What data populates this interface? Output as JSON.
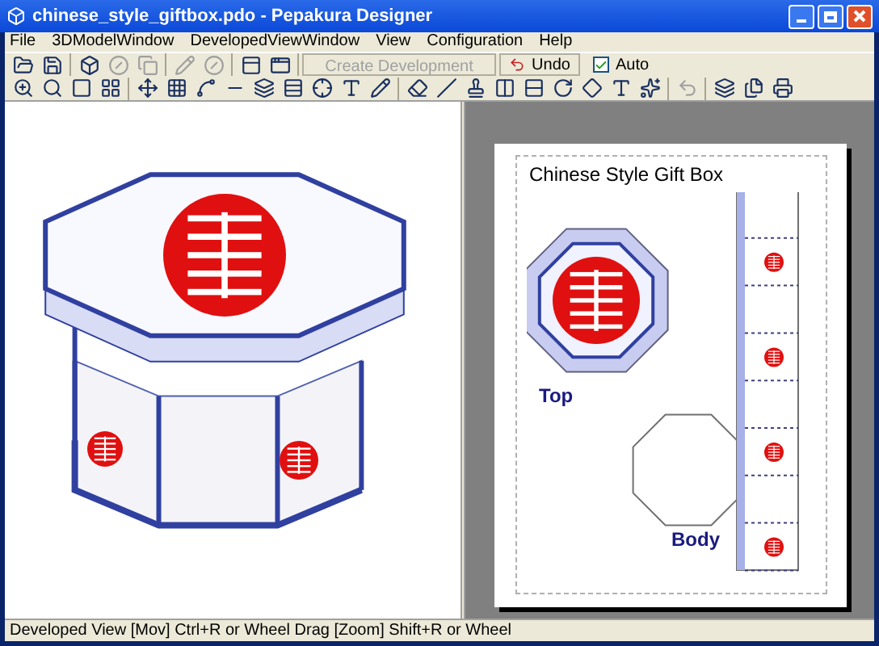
{
  "window": {
    "title": "chinese_style_giftbox.pdo - Pepakura Designer"
  },
  "menu": [
    {
      "label": "File"
    },
    {
      "label": "3DModelWindow"
    },
    {
      "label": "DevelopedViewWindow"
    },
    {
      "label": "View"
    },
    {
      "label": "Configuration"
    },
    {
      "label": "Help"
    }
  ],
  "toolbar": {
    "create_button": {
      "label": "Create Development",
      "disabled": true
    },
    "undo_button": {
      "label": "Undo"
    },
    "auto_checkbox": {
      "label": "Auto",
      "checked": true
    }
  },
  "page": {
    "title": "Chinese Style Gift Box",
    "parts": [
      {
        "label": "Top"
      },
      {
        "label": "Body"
      }
    ]
  },
  "status_bar": "Developed View [Mov] Ctrl+R or Wheel Drag [Zoom] Shift+R or Wheel"
}
